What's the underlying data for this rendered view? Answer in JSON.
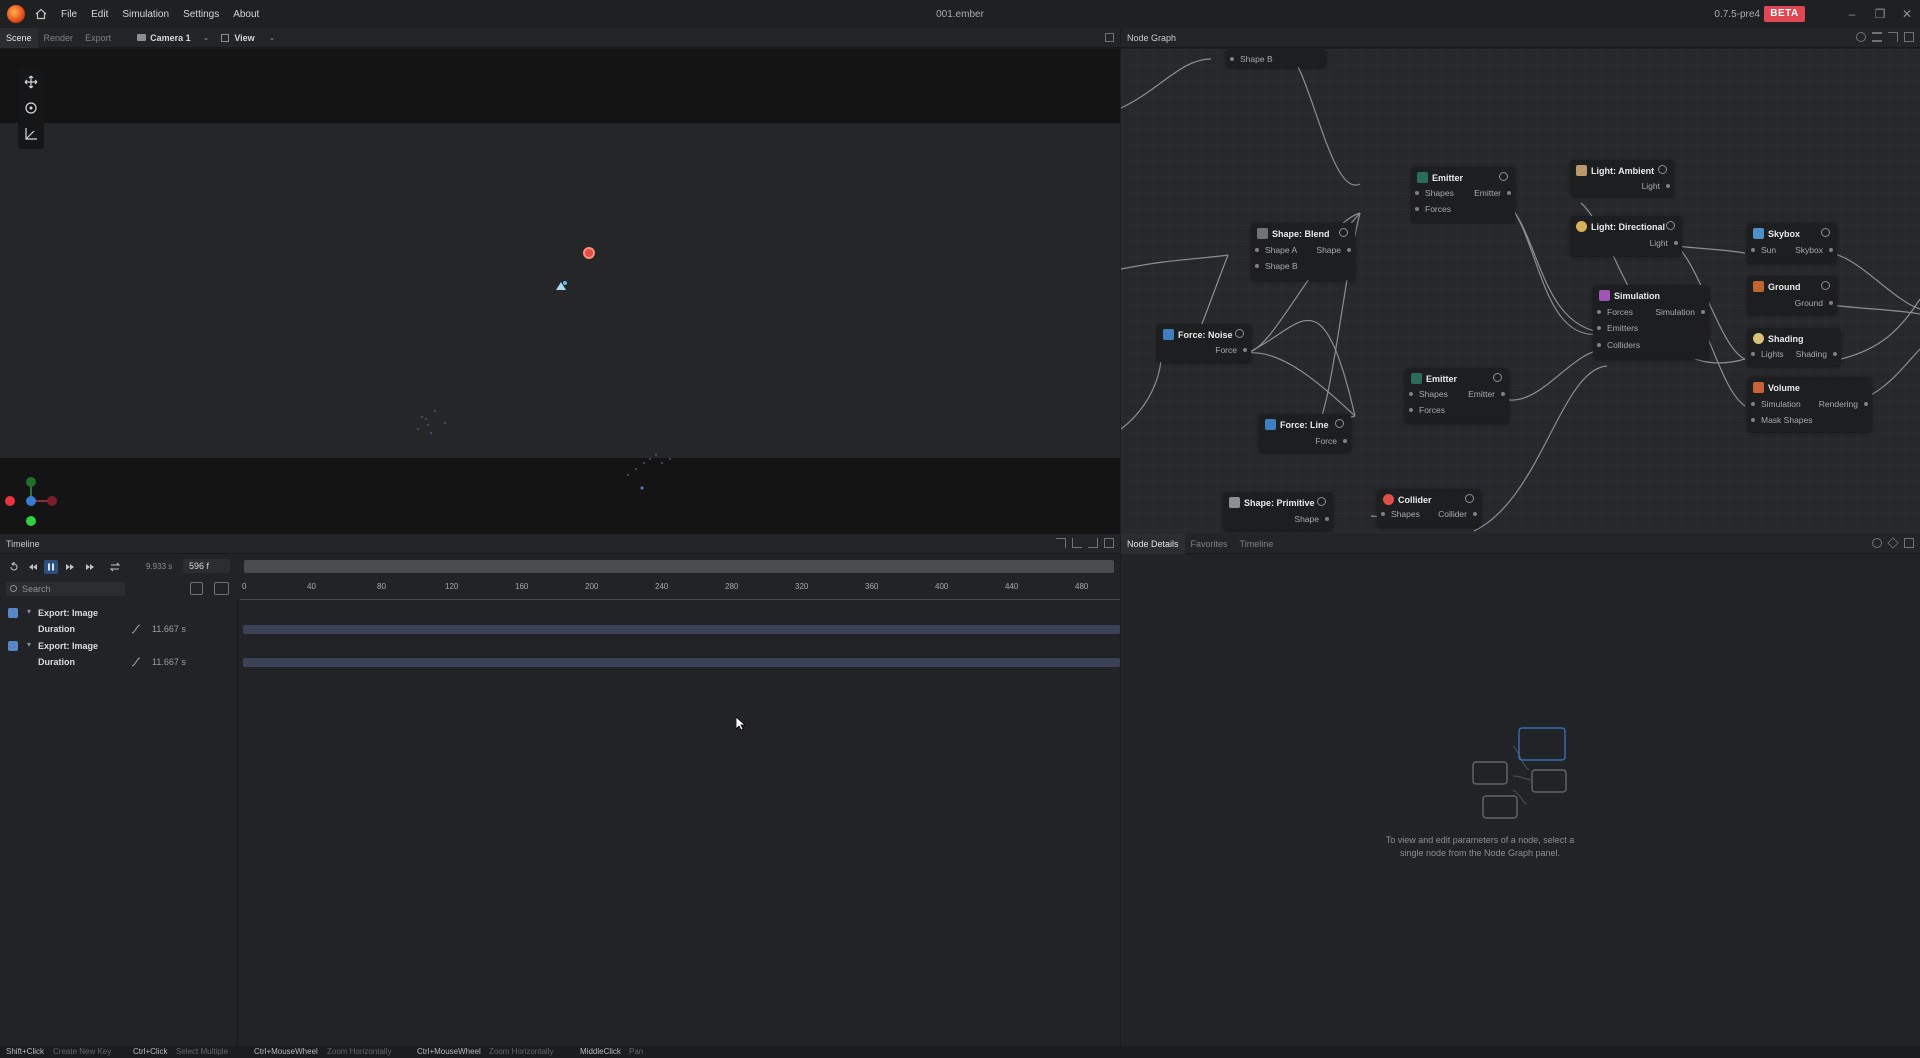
{
  "titlebar": {
    "menu": [
      "File",
      "Edit",
      "Simulation",
      "Settings",
      "About"
    ],
    "document_title": "001.ember",
    "version": "0.7.5-pre4",
    "badge": "BETA"
  },
  "scene_panel": {
    "tabs": [
      "Scene",
      "Render",
      "Export"
    ],
    "camera_label": "Camera 1",
    "view_label": "View"
  },
  "node_graph_panel": {
    "title": "Node Graph",
    "nodes": {
      "shape_b_top": {
        "ports_in": [
          "Shape B"
        ]
      },
      "emitter_1": {
        "title": "Emitter",
        "ports_in": [
          "Shapes",
          "Forces"
        ],
        "port_out": "Emitter"
      },
      "light_ambient": {
        "title": "Light: Ambient",
        "port_out": "Light"
      },
      "light_directional": {
        "title": "Light: Directional",
        "port_out": "Light"
      },
      "skybox": {
        "title": "Skybox",
        "ports_in": [
          "Sun"
        ],
        "port_out": "Skybox"
      },
      "shape_blend": {
        "title": "Shape: Blend",
        "ports_in": [
          "Shape A",
          "Shape B"
        ],
        "port_out": "Shape"
      },
      "ground": {
        "title": "Ground",
        "port_out": "Ground"
      },
      "simulation": {
        "title": "Simulation",
        "ports_in": [
          "Forces",
          "Emitters",
          "Colliders"
        ],
        "port_out": "Simulation"
      },
      "force_noise": {
        "title": "Force: Noise",
        "port_out": "Force"
      },
      "shading": {
        "title": "Shading",
        "ports_in": [
          "Lights"
        ],
        "port_out": "Shading"
      },
      "emitter_2": {
        "title": "Emitter",
        "ports_in": [
          "Shapes",
          "Forces"
        ],
        "port_out": "Emitter"
      },
      "volume": {
        "title": "Volume",
        "ports_in": [
          "Simulation",
          "Mask Shapes"
        ],
        "port_out": "Rendering"
      },
      "force_line": {
        "title": "Force: Line",
        "port_out": "Force"
      },
      "shape_primitive": {
        "title": "Shape: Primitive",
        "port_out": "Shape"
      },
      "collider": {
        "title": "Collider",
        "ports_in": [
          "Shapes"
        ],
        "port_out": "Collider"
      }
    }
  },
  "timeline_panel": {
    "title": "Timeline",
    "time_seconds": "9.933 s",
    "frame": "596 f",
    "search_placeholder": "Search",
    "ruler_ticks": [
      "0",
      "40",
      "80",
      "120",
      "160",
      "200",
      "240",
      "280",
      "320",
      "360",
      "400",
      "440",
      "480"
    ],
    "tracks": [
      {
        "group": "Export: Image",
        "param": "Duration",
        "value": "11.667 s"
      },
      {
        "group": "Export: Image",
        "param": "Duration",
        "value": "11.667 s"
      }
    ]
  },
  "details_panel": {
    "tabs": [
      "Node Details",
      "Favorites",
      "Timeline"
    ],
    "hint": "To view and edit parameters of a node, select a single node from the Node Graph panel."
  },
  "statusbar": [
    {
      "key": "Shift+Click",
      "desc": "Create New Key"
    },
    {
      "key": "Ctrl+Click",
      "desc": "Select Multiple"
    },
    {
      "key": "Ctrl+MouseWheel",
      "desc": "Zoom Horizontally"
    },
    {
      "key": "Ctrl+MouseWheel",
      "desc": "Zoom Horizontally"
    },
    {
      "key": "MiddleClick",
      "desc": "Pan"
    }
  ],
  "colors": {
    "beta": "#e04654",
    "accent_blue": "#3b7bd4",
    "track_bar": "#3b4257"
  }
}
